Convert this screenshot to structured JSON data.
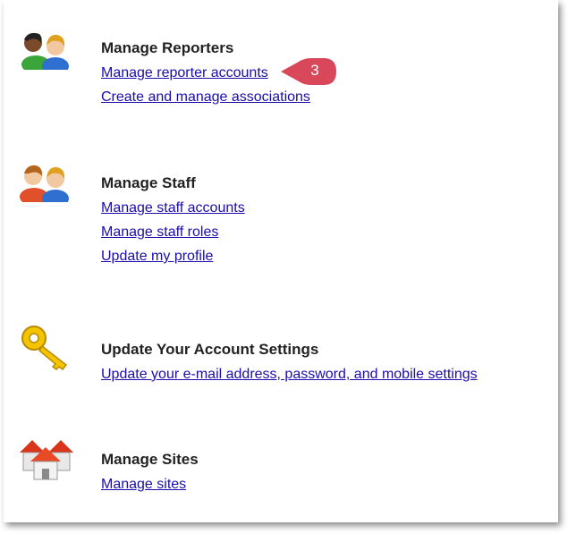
{
  "sections": [
    {
      "icon": "users-pair-icon",
      "heading": "Manage Reporters",
      "links": [
        "Manage reporter accounts",
        "Create and manage associations"
      ]
    },
    {
      "icon": "staff-pair-icon",
      "heading": "Manage Staff",
      "links": [
        "Manage staff accounts",
        "Manage staff roles",
        "Update my profile"
      ]
    },
    {
      "icon": "key-icon",
      "heading": "Update Your Account Settings",
      "links": [
        "Update your e-mail address, password, and mobile settings"
      ]
    },
    {
      "icon": "houses-icon",
      "heading": "Manage Sites",
      "links": [
        "Manage sites"
      ]
    }
  ],
  "callout": {
    "number": "3",
    "color": "#d9475a"
  },
  "colors": {
    "link": "#1a0dab",
    "heading": "#222222"
  }
}
